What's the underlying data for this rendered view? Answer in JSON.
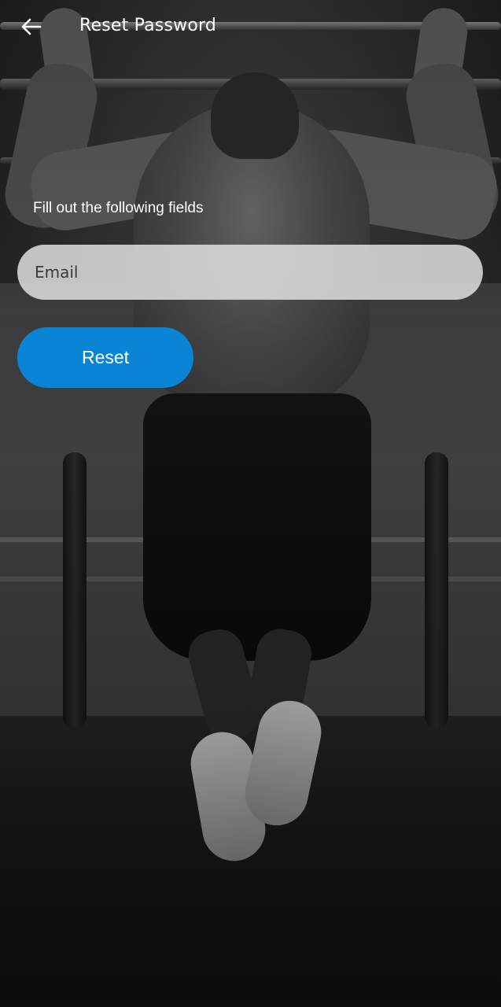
{
  "appbar": {
    "title": "Reset Password",
    "back_icon": "arrow-left-icon"
  },
  "form": {
    "instruction": "Fill out the following fields",
    "email_placeholder": "Email",
    "email_value": "",
    "reset_label": "Reset"
  },
  "colors": {
    "accent": "#0A84D4",
    "field_background": "#E6E6E6",
    "text_on_dark": "#FFFFFF"
  }
}
